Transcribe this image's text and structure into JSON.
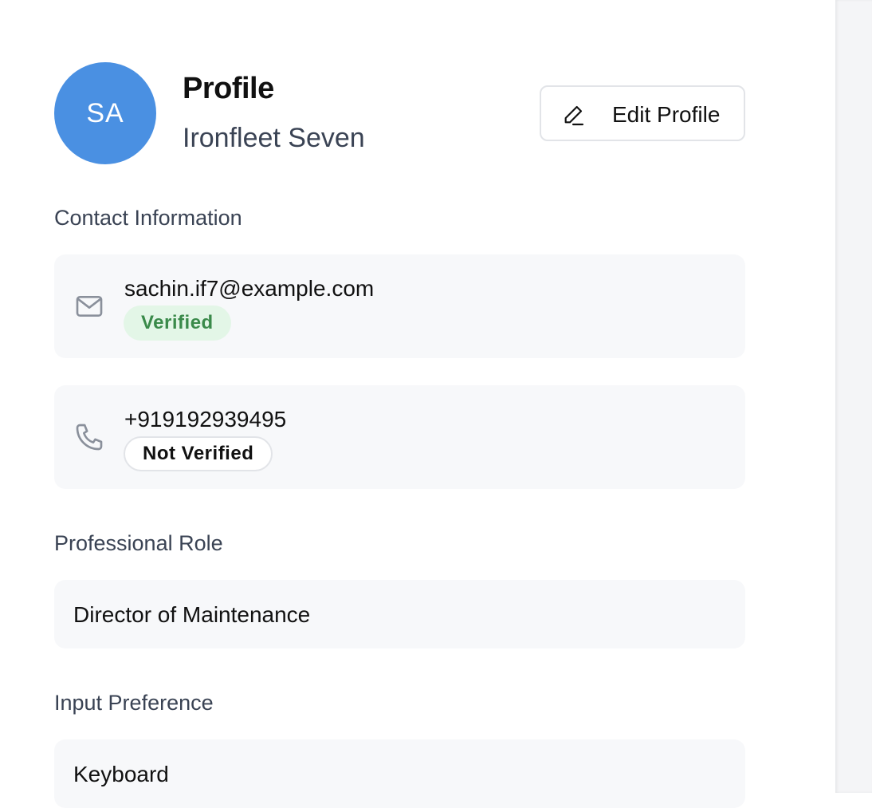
{
  "profile": {
    "avatar_initials": "SA",
    "title": "Profile",
    "name": "Ironfleet Seven",
    "edit_label": "Edit Profile",
    "avatar_color": "#4a90e2"
  },
  "contact": {
    "section_label": "Contact Information",
    "email": {
      "icon": "mail-icon",
      "value": "sachin.if7@example.com",
      "status": "Verified"
    },
    "phone": {
      "icon": "phone-icon",
      "value": "+919192939495",
      "status": "Not Verified"
    }
  },
  "role": {
    "section_label": "Professional Role",
    "value": "Director of Maintenance"
  },
  "input_pref": {
    "section_label": "Input Preference",
    "value": "Keyboard"
  },
  "colors": {
    "verified_bg": "#e3f6e7",
    "verified_text": "#3a8a4a",
    "card_bg": "#f7f8fa"
  }
}
